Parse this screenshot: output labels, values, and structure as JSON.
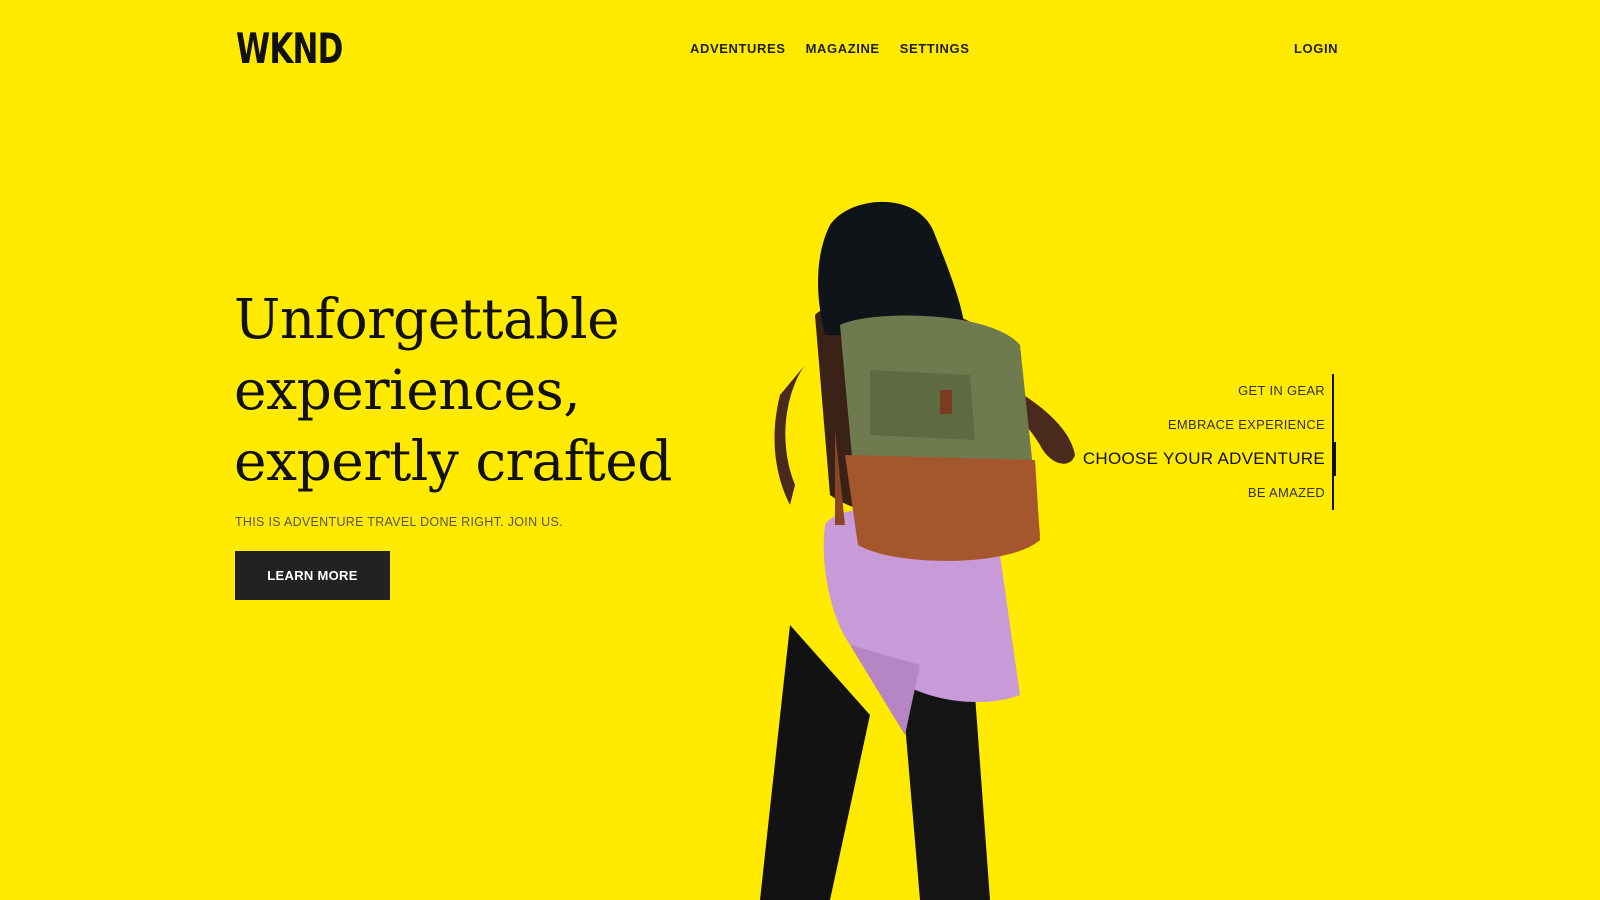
{
  "header": {
    "logo": "WKND",
    "nav": [
      "ADVENTURES",
      "MAGAZINE",
      "SETTINGS"
    ],
    "login": "LOGIN"
  },
  "hero": {
    "headline": [
      "Unforgettable",
      "experiences,",
      "expertly crafted"
    ],
    "tagline": "THIS IS ADVENTURE TRAVEL DONE RIGHT. JOIN US.",
    "cta": "LEARN MORE"
  },
  "slides": {
    "items": [
      "GET IN GEAR",
      "EMBRACE EXPERIENCE",
      "CHOOSE YOUR ADVENTURE",
      "BE AMAZED"
    ],
    "active_index": 2
  },
  "colors": {
    "background": "#FFEA00",
    "text": "#111111",
    "button": "#222222"
  }
}
